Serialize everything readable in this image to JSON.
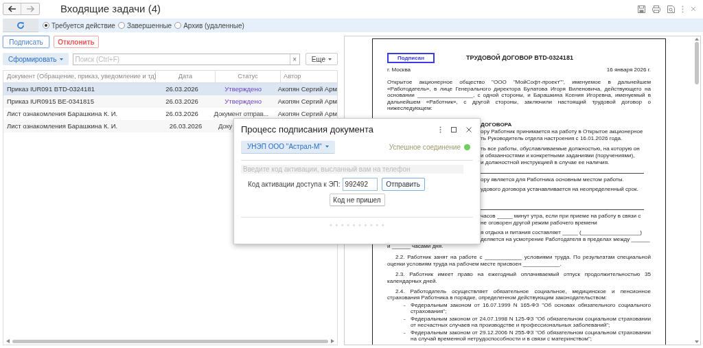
{
  "window": {
    "title": "Входящие задачи (4)"
  },
  "filters": [
    {
      "label": "Требуется действие",
      "selected": true
    },
    {
      "label": "Завершенные",
      "selected": false
    },
    {
      "label": "Архив (удаленные)",
      "selected": false
    }
  ],
  "actions": {
    "sign": "Подписать",
    "reject": "Отклонить"
  },
  "toolbar": {
    "generate": "Сформировать",
    "search_placeholder": "Поиск (Ctrl+F)",
    "clear": "×",
    "more": "Еще"
  },
  "table": {
    "columns": [
      "Документ (Обращение, приказ, уведомление и тд)",
      "Дата",
      "Статус",
      "Автор"
    ],
    "rows": [
      {
        "document": "Приказ IUR091 BTD-0324181",
        "date": "26.03.2026",
        "status": "Утверждено",
        "kind": "approved",
        "author": "Акопян Сергий Арм",
        "selected": true
      },
      {
        "document": "Приказ IUR0915 BE-0341815",
        "date": "26.03.2026",
        "status": "Утверждено",
        "kind": "approved",
        "author": "Акопян Сергий Арм",
        "selected": false
      },
      {
        "document": "Лист ознакомления Барашкина К. И.",
        "date": "26.03.2026",
        "status": "Документ отправ...",
        "kind": "sent",
        "author": "Акопян Сергий Арм",
        "selected": false
      },
      {
        "document": "Лист ознакомления Барашкина К. И.",
        "date": "26.03.2026",
        "status": "Доку",
        "kind": "sent",
        "selected": false
      }
    ]
  },
  "document": {
    "stamp": "Подписан",
    "title": "ТРУДОВОЙ ДОГОВОР BTD-0324181",
    "city": "г. Москва",
    "date": "16 января 2026 г.",
    "blocks": [
      {
        "kind": "para",
        "text": "Открытое акционерное общество \"ООО \"МойСофт-проект\"\", именуемое в дальнейшем «Работодатель», в лице Генерального директора Булатова Игоря Виленовича, действующего на основании __________________, с одной стороны, и Барашкина Ксения Игоревна, именуемый в дальнейшем «Работник», с другой стороны, заключили настоящий трудовой договор о нижеследующем:"
      },
      {
        "kind": "covered_heading",
        "text": "ДОГОВОРА"
      },
      {
        "kind": "covered",
        "text": "ору Работник принимается на работу в Открытое акционерное"
      },
      {
        "kind": "covered",
        "text": "ть Руководитель отдела настроения с 16.01.2026 года."
      },
      {
        "kind": "gap"
      },
      {
        "kind": "covered",
        "text": "ть все работы, обуславливаемые должностью, на которую он"
      },
      {
        "kind": "covered",
        "text": "и обязанностями и конкретными заданиями (поручениями),"
      },
      {
        "kind": "covered",
        "text": "и должностной инструкцией в случае ее наличия."
      },
      {
        "kind": "blank_line"
      },
      {
        "kind": "covered",
        "text": "ору является для Работника основным местом работы."
      },
      {
        "kind": "gap"
      },
      {
        "kind": "covered",
        "text": "удового договора устанавливается на неопределенный срок."
      },
      {
        "kind": "gap"
      },
      {
        "kind": "gap"
      },
      {
        "kind": "gap"
      },
      {
        "kind": "blank_line"
      },
      {
        "kind": "covered",
        "text": "часов _____ минут утра, если при приеме на работу в связи с"
      },
      {
        "kind": "covered",
        "text": "не оговорен другой режим рабочего времени"
      },
      {
        "kind": "gap"
      },
      {
        "kind": "covered",
        "text": "я отдыха и питания составляет _____ (___________________)"
      },
      {
        "kind": "covered",
        "text": "деляется на усмотрение Работодателя в пределах между ______"
      },
      {
        "kind": "line",
        "text": "и ______ часами дня."
      },
      {
        "kind": "item",
        "text": "2.2. Работник занят на работе с ____________ условиями труда. По результатам специальной оценки условиям труда на рабочем месте присвоен ____________."
      },
      {
        "kind": "item",
        "text": "2.3. Работник имеет право на ежегодный оплачиваемый отпуск продолжительностью 35 календарных дней."
      },
      {
        "kind": "item",
        "text": "2.4. Работодатель осуществляет обязательное социальное, медицинское и пенсионное страхования Работника в порядке, определенном действующим законодательством:"
      },
      {
        "kind": "bullet",
        "mark": "-",
        "text": "Федеральным законом от 16.07.1999 N 165-ФЗ \"Об основах обязательного социального страхования\";"
      },
      {
        "kind": "bullet",
        "mark": "-",
        "text": "Федеральным законом от 24.07.1998 N 125-ФЗ \"Об обязательном социальном страховании от несчастных случаев на производстве и профессиональных заболеваний\";"
      },
      {
        "kind": "bullet",
        "mark": "-",
        "text": "Федеральным законом от 29.12.2006 N 255-ФЗ \"Об обязательном социальном страховании на случай временной нетрудоспособности и в связи с материнством\";"
      }
    ]
  },
  "dialog": {
    "title": "Процесс подписания документа",
    "certificate": "УНЭП ООО \"Астрал-М\"",
    "connection": "Успешное соединение",
    "connected": true,
    "hint_placeholder": "Введите код активации, высланный вам на телефон",
    "code_label": "Код активации доступа к ЭП:",
    "code_value": "992492",
    "send": "Отправить",
    "no_code": "Код не пришел"
  }
}
